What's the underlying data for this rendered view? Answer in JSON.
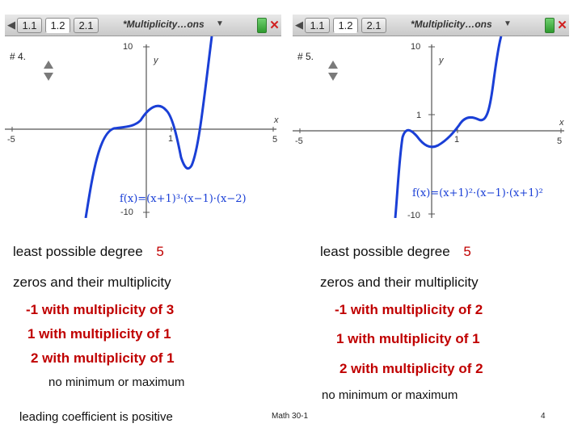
{
  "panels": [
    {
      "tabs": [
        "1.1",
        "1.2",
        "2.1"
      ],
      "active_tab": 1,
      "doc_title": "*Multiplicity…ons",
      "page_label": "# 4.",
      "axis": {
        "x_label": "x",
        "y_label": "y",
        "x_min": "-5",
        "x_max": "5",
        "y_max": "10",
        "y_min": "-10",
        "tick_x1": "1",
        "tick_y1": ""
      },
      "function_label": "f(x)=(x+1)³·(x−1)·(x−2)"
    },
    {
      "tabs": [
        "1.1",
        "1.2",
        "2.1"
      ],
      "active_tab": 1,
      "doc_title": "*Multiplicity…ons",
      "page_label": "# 5.",
      "axis": {
        "x_label": "x",
        "y_label": "y",
        "x_min": "-5",
        "x_max": "5",
        "y_max": "10",
        "y_min": "-10",
        "tick_x1": "1",
        "tick_y1": "1"
      },
      "function_label": "f(x)=(x+1)²·(x−1)·(x+1)²"
    }
  ],
  "left_text": {
    "degree_label": "least possible degree",
    "degree_value": "5",
    "zeros_heading": "zeros and their multiplicity",
    "zero_lines": [
      "-1 with multiplicity of 3",
      "1 with multiplicity of 1",
      "2 with multiplicity of 1"
    ],
    "extrema": "no minimum or maximum",
    "leading": "leading coefficient is positive"
  },
  "right_text": {
    "degree_label": "least possible degree",
    "degree_value": "5",
    "zeros_heading": "zeros and their multiplicity",
    "zero_lines": [
      "-1 with multiplicity of 2",
      "1 with multiplicity of 1",
      "2 with multiplicity of 2"
    ],
    "extrema": "no minimum or maximum"
  },
  "footer": {
    "course": "Math 30-1",
    "page_number": "4"
  },
  "colors": {
    "curve": "#1a3fd6",
    "highlight": "#c00000",
    "function_label": "#1a3fd6"
  }
}
